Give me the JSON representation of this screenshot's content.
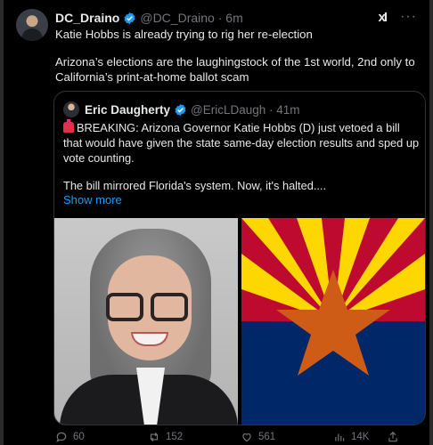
{
  "post": {
    "author_name": "DC_Draino",
    "author_handle": "@DC_Draino",
    "time": "6m",
    "text_line1": "Katie Hobbs is already trying to rig her re-election",
    "text_line2": "Arizona’s elections are the laughingstock of the 1st world, 2nd only to California’s print-at-home ballot scam",
    "grok_icon": "xI",
    "more_icon": "···"
  },
  "quote": {
    "author_name": "Eric Daugherty",
    "author_handle": "@EricLDaugh",
    "time": "41m",
    "emoji": "siren-icon",
    "text_p1": "BREAKING: Arizona Governor Katie Hobbs (D) just vetoed a bill that would have given the state same-day election results and sped up vote counting.",
    "text_p2": "The bill mirrored Florida's system. Now, it's halted....",
    "show_more": "Show more"
  },
  "actions": {
    "replies": "60",
    "reposts": "152",
    "likes": "561",
    "views": "14K"
  },
  "colors": {
    "verified": "#1d9bf0",
    "link": "#1d9bf0",
    "flag_red": "#bf0a30",
    "flag_yellow": "#fed700",
    "flag_blue": "#002868",
    "flag_copper": "#ce5c17"
  }
}
